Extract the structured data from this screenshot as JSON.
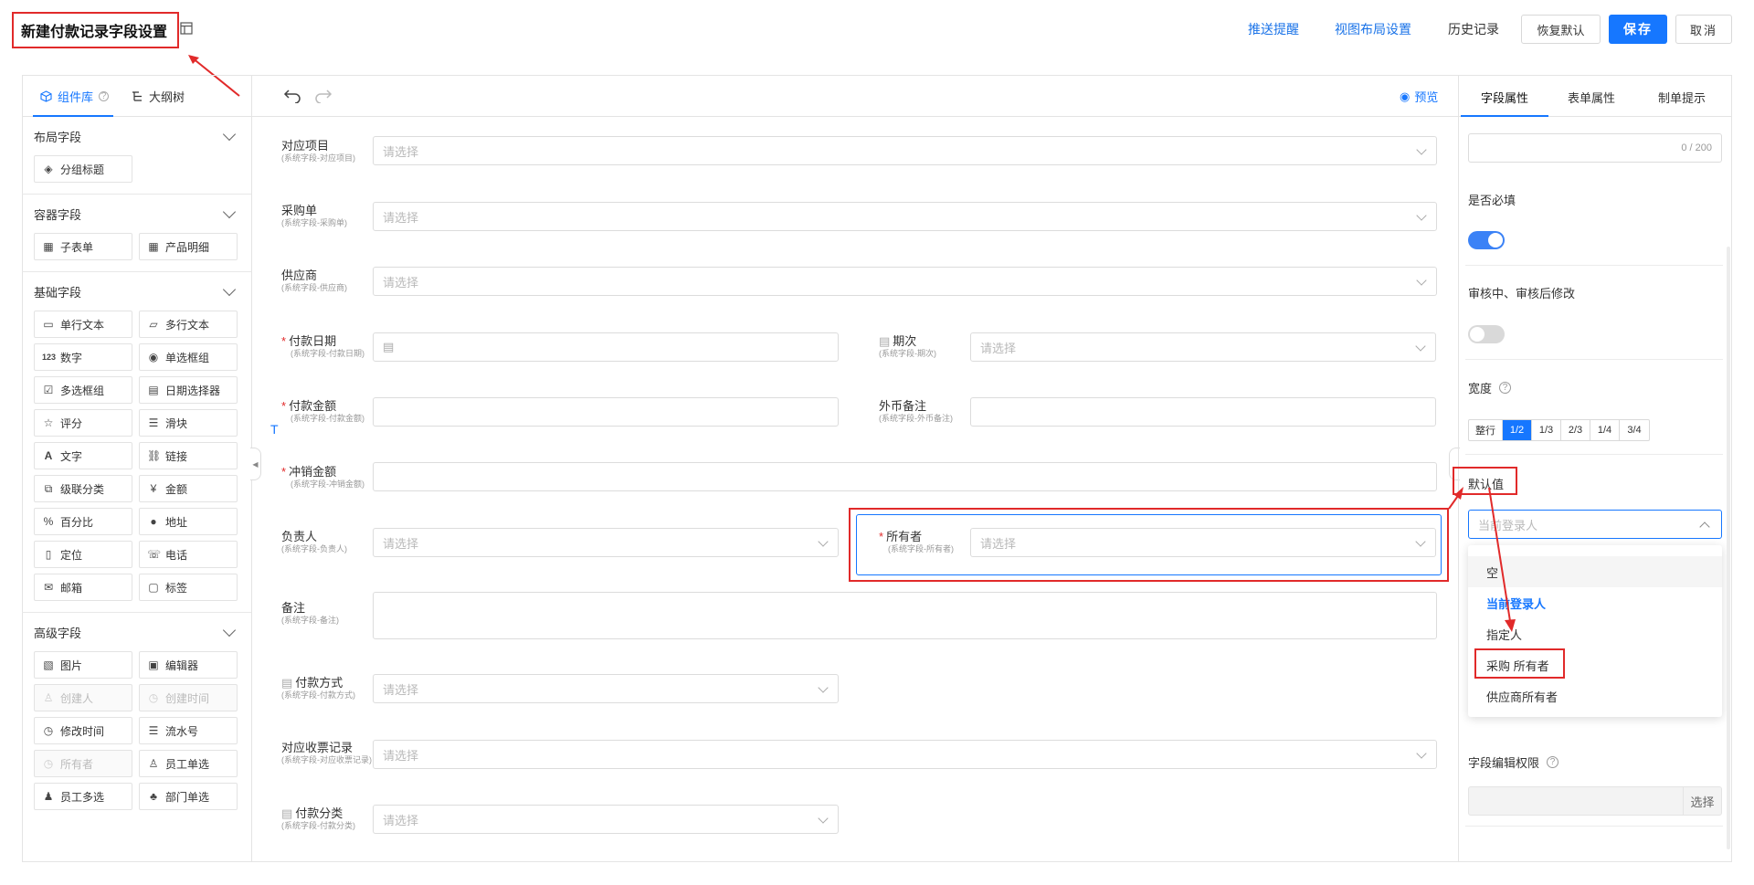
{
  "header": {
    "title": "新建付款记录字段设置",
    "push_reminder": "推送提醒",
    "view_layout": "视图布局设置",
    "history": "历史记录",
    "restore_default": "恢复默认",
    "save": "保存",
    "cancel": "取消"
  },
  "left": {
    "tab_components": "组件库",
    "tab_outline": "大纲树",
    "sections": {
      "layout": {
        "title": "布局字段",
        "items": [
          "分组标题"
        ]
      },
      "container": {
        "title": "容器字段",
        "items": [
          "子表单",
          "产品明细"
        ]
      },
      "basic": {
        "title": "基础字段",
        "items": [
          "单行文本",
          "多行文本",
          "数字",
          "单选框组",
          "多选框组",
          "日期选择器",
          "评分",
          "滑块",
          "文字",
          "链接",
          "级联分类",
          "金额",
          "百分比",
          "地址",
          "定位",
          "电话",
          "邮箱",
          "标签"
        ]
      },
      "advanced": {
        "title": "高级字段",
        "items": [
          "图片",
          "编辑器",
          "创建人",
          "创建时间",
          "修改时间",
          "流水号",
          "所有者",
          "员工单选",
          "员工多选",
          "部门单选"
        ]
      }
    }
  },
  "center": {
    "preview": "预览",
    "fields": {
      "f1": {
        "label": "对应项目",
        "sub": "(系统字段-对应项目)",
        "placeholder": "请选择"
      },
      "f2": {
        "label": "采购单",
        "sub": "(系统字段-采购单)",
        "placeholder": "请选择"
      },
      "f3": {
        "label": "供应商",
        "sub": "(系统字段-供应商)",
        "placeholder": "请选择"
      },
      "f4": {
        "label": "付款日期",
        "sub": "(系统字段-付款日期)"
      },
      "f5": {
        "label": "期次",
        "sub": "(系统字段-期次)",
        "placeholder": "请选择"
      },
      "f6": {
        "label": "付款金额",
        "sub": "(系统字段-付款金额)"
      },
      "f7": {
        "label": "外币备注",
        "sub": "(系统字段-外币备注)"
      },
      "f8": {
        "label": "冲销金额",
        "sub": "(系统字段-冲销金额)"
      },
      "f9": {
        "label": "负责人",
        "sub": "(系统字段-负责人)",
        "placeholder": "请选择"
      },
      "f10": {
        "label": "所有者",
        "sub": "(系统字段-所有者)",
        "placeholder": "请选择"
      },
      "f11": {
        "label": "备注",
        "sub": "(系统字段-备注)"
      },
      "f12": {
        "label": "付款方式",
        "sub": "(系统字段-付款方式)",
        "placeholder": "请选择"
      },
      "f13": {
        "label": "对应收票记录",
        "sub": "(系统字段-对应收票记录)",
        "placeholder": "请选择"
      },
      "f14": {
        "label": "付款分类",
        "sub": "(系统字段-付款分类)",
        "placeholder": "请选择"
      }
    }
  },
  "right": {
    "tab_field": "字段属性",
    "tab_form": "表单属性",
    "tab_tips": "制单提示",
    "counter": "0 / 200",
    "required_label": "是否必填",
    "required_on": true,
    "edit_after_label": "审核中、审核后修改",
    "edit_after_on": false,
    "width_label": "宽度",
    "width_options": [
      "整行",
      "1/2",
      "1/3",
      "2/3",
      "1/4",
      "3/4"
    ],
    "width_selected": "1/2",
    "default_label": "默认值",
    "default_placeholder": "当前登录人",
    "dropdown": [
      "空",
      "当前登录人",
      "指定人",
      "采购 所有者",
      "供应商所有者"
    ],
    "perm_label": "字段编辑权限",
    "perm_button": "选择"
  }
}
